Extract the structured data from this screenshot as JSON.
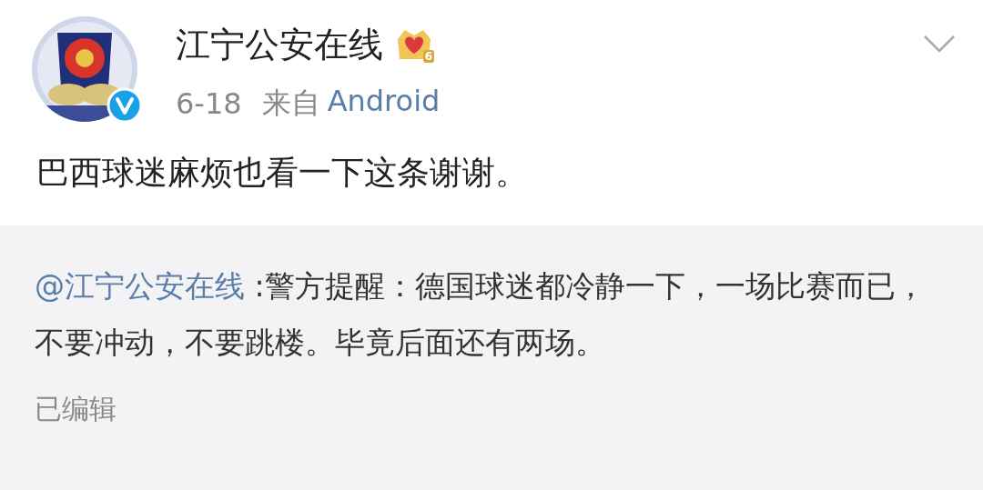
{
  "post": {
    "author": "江宁公安在线",
    "verified": true,
    "member_level": "6",
    "date": "6-18",
    "source_prefix": "来自",
    "source": "Android",
    "text": "巴西球迷麻烦也看一下这条谢谢。"
  },
  "quote": {
    "mention": "@江宁公安在线",
    "text": " :警方提醒：德国球迷都冷静一下，一场比赛而已，不要冲动，不要跳楼。毕竟后面还有两场。",
    "note": "已编辑"
  }
}
